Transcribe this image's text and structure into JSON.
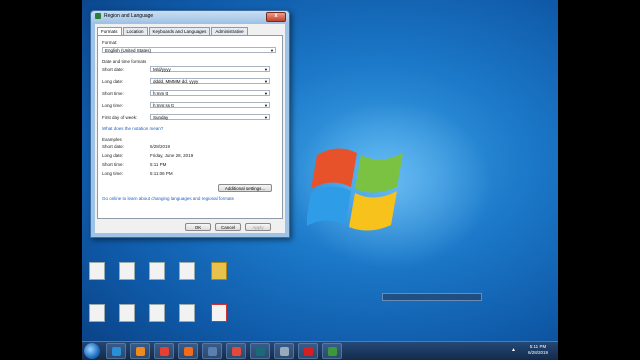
{
  "window": {
    "title": "Region and Language",
    "close_label": "x"
  },
  "tabs": [
    {
      "label": "Formats"
    },
    {
      "label": "Location"
    },
    {
      "label": "Keyboards and Languages"
    },
    {
      "label": "Administrative"
    }
  ],
  "format": {
    "label": "Format:",
    "value": "English (United States)"
  },
  "date_time": {
    "heading": "Date and time formats",
    "short_date_label": "Short date:",
    "short_date_value": "M/d/yyyy",
    "long_date_label": "Long date:",
    "long_date_value": "dddd, MMMM dd, yyyy",
    "short_time_label": "Short time:",
    "short_time_value": "h:mm tt",
    "long_time_label": "Long time:",
    "long_time_value": "h:mm:ss tt",
    "first_day_label": "First day of week:",
    "first_day_value": "Sunday"
  },
  "notation_link": "What does the notation mean?",
  "examples": {
    "heading": "Examples",
    "short_date_label": "Short date:",
    "short_date_value": "6/28/2019",
    "long_date_label": "Long date:",
    "long_date_value": "Friday, June 28, 2019",
    "short_time_label": "Short time:",
    "short_time_value": "5:11 PM",
    "long_time_label": "Long time:",
    "long_time_value": "5:11:06 PM"
  },
  "additional_settings": "Additional settings...",
  "online_link": "Go online to learn about changing languages and regional formats",
  "buttons": {
    "ok": "OK",
    "cancel": "Cancel",
    "apply": "Apply"
  },
  "desktop_icons": {
    "row1_captions": [
      "",
      "",
      "",
      "",
      ""
    ],
    "row2": [
      {
        "icon": "document-icon",
        "caption": ""
      },
      {
        "icon": "document-icon",
        "caption": ""
      },
      {
        "icon": "document-icon",
        "caption": ""
      },
      {
        "icon": "document-icon",
        "caption": ""
      },
      {
        "icon": "folder-icon",
        "caption": ""
      }
    ],
    "row3": [
      {
        "icon": "document-icon",
        "caption": ""
      },
      {
        "icon": "document-icon",
        "caption": ""
      },
      {
        "icon": "document-icon",
        "caption": ""
      },
      {
        "icon": "document-icon",
        "caption": ""
      },
      {
        "icon": "document-icon",
        "caption": ""
      }
    ]
  },
  "taskbar": {
    "items": [
      {
        "icon": "ie-icon",
        "color": "#2a8fd6"
      },
      {
        "icon": "media-player-icon",
        "color": "#f08a1c"
      },
      {
        "icon": "chrome-icon",
        "color": "#e34133"
      },
      {
        "icon": "firefox-icon",
        "color": "#f26b1d"
      },
      {
        "icon": "app-icon",
        "color": "#5b7fb0"
      },
      {
        "icon": "gem-icon",
        "color": "#e04a3a"
      },
      {
        "icon": "terminal-icon",
        "color": "#1a6b7a"
      },
      {
        "icon": "window-icon",
        "color": "#9ab"
      },
      {
        "icon": "record-icon",
        "color": "#d42020"
      },
      {
        "icon": "globe-icon",
        "color": "#3a9a3a"
      }
    ],
    "time": "5:11 PM",
    "date": "6/28/2019"
  },
  "colors": {
    "link": "#1f5fbf",
    "accent": "#1c79c9"
  }
}
